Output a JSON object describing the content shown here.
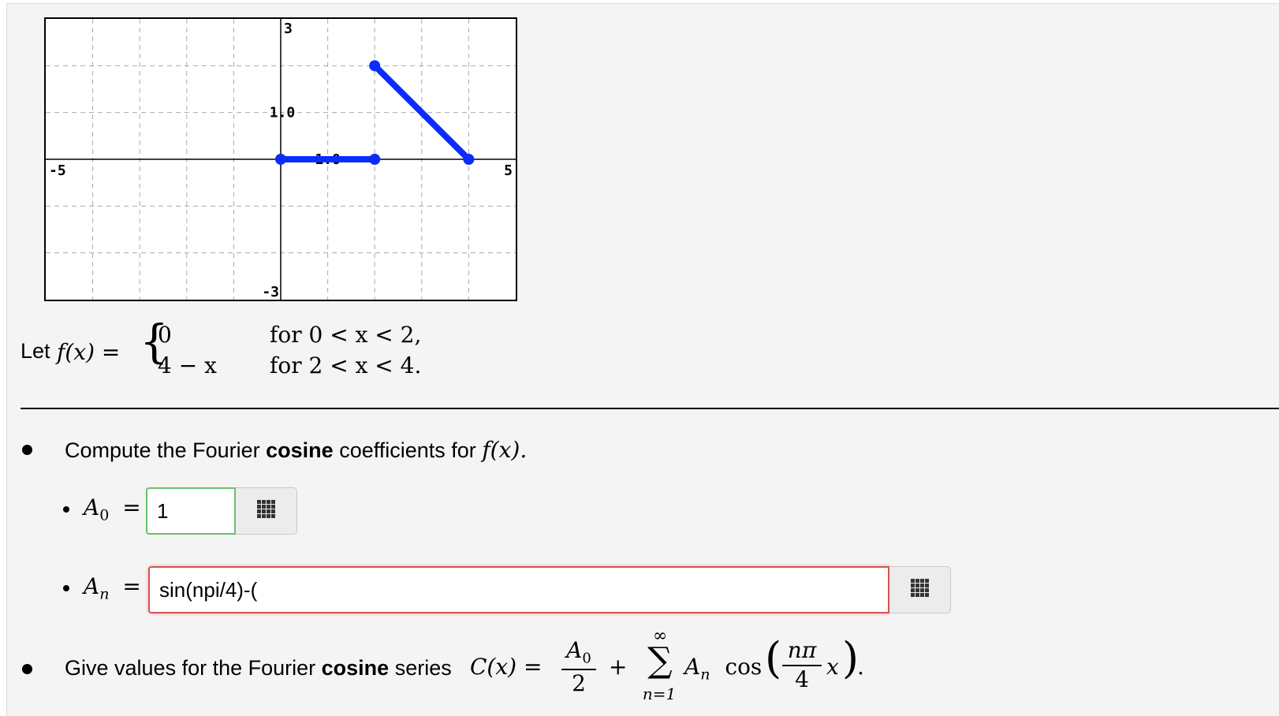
{
  "graph": {
    "tick_labels": {
      "y_top": "3",
      "y_bottom": "-3",
      "x_left": "-5",
      "x_right": "5",
      "y_mid": "1.0",
      "x_mid": "1.0"
    },
    "line_color": "#0a2cff",
    "chart_data": {
      "type": "line",
      "xlim": [
        -5,
        5
      ],
      "ylim": [
        -3,
        3
      ],
      "grid": true,
      "series": [
        {
          "x": [
            0,
            2
          ],
          "y": [
            0,
            0
          ]
        },
        {
          "x": [
            2,
            4
          ],
          "y": [
            2,
            0
          ]
        }
      ]
    }
  },
  "definition": {
    "let": "Let",
    "lhs": "f(x) =",
    "cases": [
      {
        "expr": "0",
        "cond": "for  0 < x < 2,"
      },
      {
        "expr": "4 − x",
        "cond": "for  2 < x < 4."
      }
    ]
  },
  "task1": {
    "prefix": "Compute the Fourier",
    "bold": "cosine",
    "suffix": "coefficients for",
    "func": "f(x)."
  },
  "a0": {
    "label": "A",
    "sub": "0",
    "eq": "=",
    "value": "1"
  },
  "an": {
    "label": "A",
    "sub": "n",
    "eq": "=",
    "value": "sin(npi/4)-("
  },
  "task2": {
    "prefix": "Give values for the Fourier",
    "bold": "cosine",
    "suffix": "series",
    "lhs": "C(x) =",
    "frac_num": "A",
    "frac_num_sub": "0",
    "frac_den": "2",
    "plus": "+",
    "sum_top": "∞",
    "sum_sym": "∑",
    "sum_bottom": "n=1",
    "term": "A",
    "term_sub": "n",
    "cos": "cos",
    "arg_num": "nπ",
    "arg_den": "4",
    "arg_x": "x",
    "end": "."
  }
}
